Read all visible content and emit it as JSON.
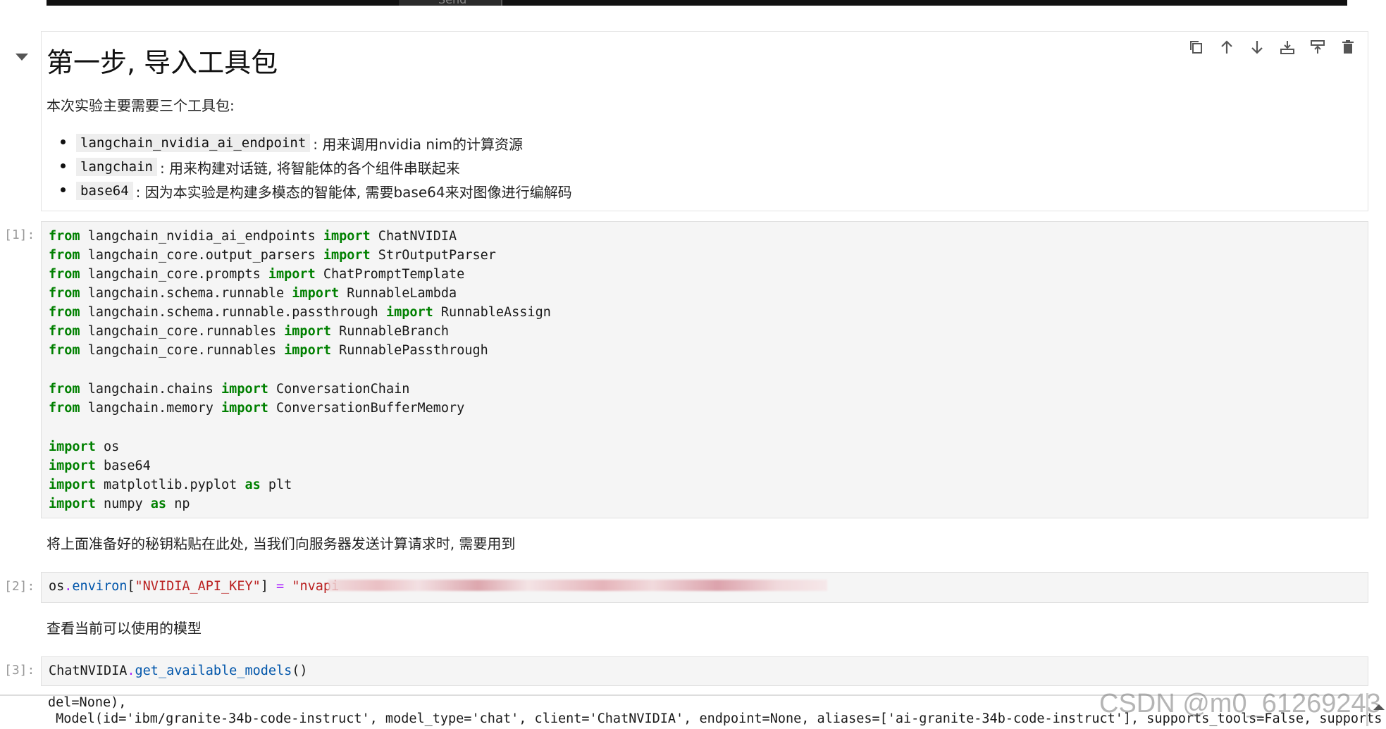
{
  "top": {
    "send_label": "Send"
  },
  "md1": {
    "title": "第一步, 导入工具包",
    "intro": "本次实验主要需要三个工具包:",
    "bullets": [
      {
        "code": "langchain_nvidia_ai_endpoint",
        "text": ": 用来调用nvidia nim的计算资源"
      },
      {
        "code": "langchain",
        "text": ": 用来构建对话链, 将智能体的各个组件串联起来"
      },
      {
        "code": "base64",
        "text": ": 因为本实验是构建多模态的智能体, 需要base64来对图像进行编解码"
      }
    ]
  },
  "toolbar": {
    "icons": [
      "duplicate-icon",
      "move-up-icon",
      "move-down-icon",
      "insert-below-icon",
      "insert-above-icon",
      "delete-icon"
    ]
  },
  "cell1": {
    "prompt": "[1]:",
    "lines": [
      {
        "kw1": "from",
        "mod": " langchain_nvidia_ai_endpoints ",
        "kw2": "import",
        "name": " ChatNVIDIA"
      },
      {
        "kw1": "from",
        "mod": " langchain_core.output_parsers ",
        "kw2": "import",
        "name": " StrOutputParser"
      },
      {
        "kw1": "from",
        "mod": " langchain_core.prompts ",
        "kw2": "import",
        "name": " ChatPromptTemplate"
      },
      {
        "kw1": "from",
        "mod": " langchain.schema.runnable ",
        "kw2": "import",
        "name": " RunnableLambda"
      },
      {
        "kw1": "from",
        "mod": " langchain.schema.runnable.passthrough ",
        "kw2": "import",
        "name": " RunnableAssign"
      },
      {
        "kw1": "from",
        "mod": " langchain_core.runnables ",
        "kw2": "import",
        "name": " RunnableBranch"
      },
      {
        "kw1": "from",
        "mod": " langchain_core.runnables ",
        "kw2": "import",
        "name": " RunnablePassthrough"
      },
      {
        "kw1": "from",
        "mod": " langchain.chains ",
        "kw2": "import",
        "name": " ConversationChain"
      },
      {
        "kw1": "from",
        "mod": " langchain.memory ",
        "kw2": "import",
        "name": " ConversationBufferMemory"
      },
      {
        "kw1": "import",
        "mod": " os",
        "kw2": "",
        "name": ""
      },
      {
        "kw1": "import",
        "mod": " base64",
        "kw2": "",
        "name": ""
      },
      {
        "kw1": "import",
        "mod": " matplotlib.pyplot ",
        "kw2": "as",
        "name": " plt"
      },
      {
        "kw1": "import",
        "mod": " numpy ",
        "kw2": "as",
        "name": " np"
      }
    ]
  },
  "md2": {
    "text": "将上面准备好的秘钥粘贴在此处, 当我们向服务器发送计算请求时, 需要用到"
  },
  "cell2": {
    "prompt": "[2]:",
    "obj": "os",
    "dot": ".",
    "attr": "environ",
    "bracket_open": "[",
    "key": "\"NVIDIA_API_KEY\"",
    "bracket_close": "]",
    "eq": " = ",
    "value": "\"nvapi"
  },
  "md3": {
    "text": "查看当前可以使用的模型"
  },
  "cell3": {
    "prompt": "[3]:",
    "obj": "ChatNVIDIA",
    "dot": ".",
    "method": "get_available_models",
    "parens": "()"
  },
  "output": {
    "line1": "del=None),",
    "line2": " Model(id='ibm/granite-34b-code-instruct', model_type='chat', client='ChatNVIDIA', endpoint=None, aliases=['ai-granite-34b-code-instruct'], supports_tools=False, supports"
  },
  "watermark": "CSDN @m0_61269243"
}
